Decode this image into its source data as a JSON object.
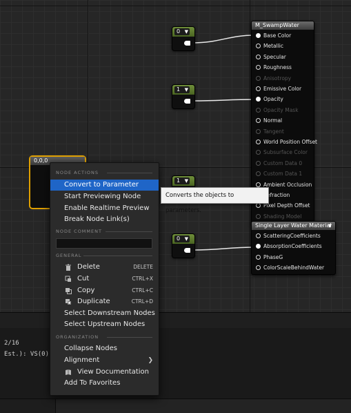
{
  "graph": {
    "constants": [
      {
        "value": "0"
      },
      {
        "value": "1"
      },
      {
        "value": "1"
      },
      {
        "value": "0"
      }
    ],
    "selected_node": {
      "title": "0,0,0"
    },
    "material_node": {
      "title": "M_SwampWater",
      "pins": [
        {
          "label": "Base Color",
          "connected": true,
          "enabled": true
        },
        {
          "label": "Metallic",
          "connected": false,
          "enabled": true
        },
        {
          "label": "Specular",
          "connected": false,
          "enabled": true
        },
        {
          "label": "Roughness",
          "connected": false,
          "enabled": true
        },
        {
          "label": "Anisotropy",
          "connected": false,
          "enabled": false
        },
        {
          "label": "Emissive Color",
          "connected": false,
          "enabled": true
        },
        {
          "label": "Opacity",
          "connected": true,
          "enabled": true
        },
        {
          "label": "Opacity Mask",
          "connected": false,
          "enabled": false
        },
        {
          "label": "Normal",
          "connected": false,
          "enabled": true
        },
        {
          "label": "Tangent",
          "connected": false,
          "enabled": false
        },
        {
          "label": "World Position Offset",
          "connected": false,
          "enabled": true
        },
        {
          "label": "Subsurface Color",
          "connected": false,
          "enabled": false
        },
        {
          "label": "Custom Data 0",
          "connected": false,
          "enabled": false
        },
        {
          "label": "Custom Data 1",
          "connected": false,
          "enabled": false
        },
        {
          "label": "Ambient Occlusion",
          "connected": false,
          "enabled": true
        },
        {
          "label": "Refraction",
          "connected": false,
          "enabled": true
        },
        {
          "label": "Pixel Depth Offset",
          "connected": false,
          "enabled": true
        },
        {
          "label": "Shading Model",
          "connected": false,
          "enabled": false
        }
      ]
    },
    "water_node": {
      "title": "Single Layer Water Material",
      "pins": [
        {
          "label": "ScatteringCoefficients",
          "connected": false
        },
        {
          "label": "AbsorptionCoefficients",
          "connected": true
        },
        {
          "label": "PhaseG",
          "connected": false
        },
        {
          "label": "ColorScaleBehindWater",
          "connected": false
        }
      ]
    }
  },
  "context_menu": {
    "sections": {
      "node_actions": "NODE ACTIONS",
      "node_comment": "NODE COMMENT",
      "general": "GENERAL",
      "organization": "ORGANIZATION"
    },
    "node_actions": [
      {
        "label": "Convert to Parameter",
        "highlighted": true
      },
      {
        "label": "Start Previewing Node"
      },
      {
        "label": "Enable Realtime Preview"
      },
      {
        "label": "Break Node Link(s)"
      }
    ],
    "general": [
      {
        "label": "Delete",
        "shortcut": "DELETE",
        "icon": "trash-icon"
      },
      {
        "label": "Cut",
        "shortcut": "CTRL+X",
        "icon": "cut-icon"
      },
      {
        "label": "Copy",
        "shortcut": "CTRL+C",
        "icon": "copy-icon"
      },
      {
        "label": "Duplicate",
        "shortcut": "CTRL+D",
        "icon": "duplicate-icon"
      },
      {
        "label": "Select Downstream Nodes"
      },
      {
        "label": "Select Upstream Nodes"
      }
    ],
    "organization": [
      {
        "label": "Collapse Nodes"
      },
      {
        "label": "Alignment",
        "submenu": true
      },
      {
        "label": "View Documentation",
        "icon": "book-icon"
      },
      {
        "label": "Add To Favorites"
      }
    ]
  },
  "tooltip": {
    "text": "Converts the objects to parameters."
  },
  "stats": {
    "line1": "2/16",
    "line2": "Est.): VS(0)"
  },
  "colors": {
    "highlight": "#1f65c7",
    "selection": "#e0a000",
    "constant_header": "#5d7d2c"
  }
}
